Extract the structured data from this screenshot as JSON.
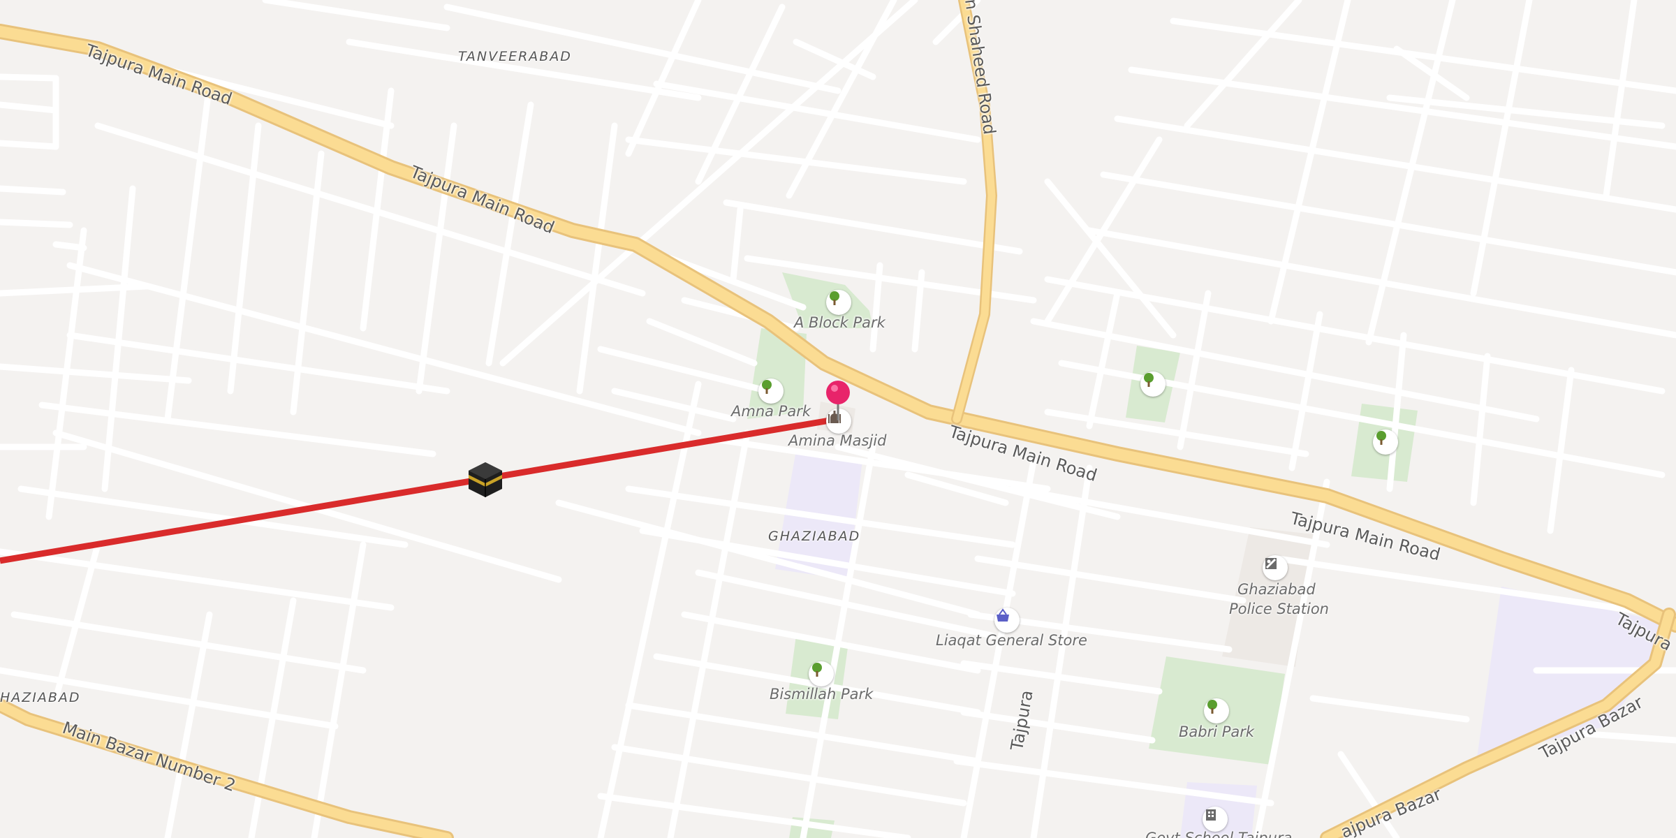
{
  "map": {
    "areas": {
      "tanveerabad": "TANVEERABAD",
      "ghaziabad": "GHAZIABAD",
      "ghaziabad_edge": "HAZIABAD"
    },
    "roads": {
      "tajpura_main_1": "Tajpura Main Road",
      "tajpura_main_2": "Tajpura Main Road",
      "tajpura_main_3": "Tajpura Main Road",
      "tajpura_main_4": "Tajpura Main Road",
      "tajpura_main_5": "Tajpura",
      "shaheed_road": "n Shaheed Road",
      "tajpura_street": "Tajpura",
      "main_bazar_2": "Main Bazar Number 2",
      "tajpura_bazar_1": "Tajpura Bazar",
      "tajpura_bazar_2": "ajpura Bazar"
    },
    "pois": {
      "a_block_park": "A Block Park",
      "amna_park": "Amna Park",
      "amina_masjid": "Amina Masjid",
      "liaqat_store": "Liaqat General Store",
      "bismillah_park": "Bismillah Park",
      "police_station_1": "Ghaziabad",
      "police_station_2": "Police Station",
      "babri_park": "Babri Park",
      "govt_school": "Govt School Tajpura"
    },
    "colors": {
      "background": "#f4f2f0",
      "minor_road": "#ffffff",
      "major_road": "#fbdc93",
      "major_road_casing": "#e8c27b",
      "park": "#d8ead0",
      "school": "#ece8f8",
      "route_line": "#d92b2b",
      "pin": "#e8246a",
      "tree_icon": "#5a9e2f"
    },
    "icons": {
      "pin": "location-pin-icon",
      "kaaba": "kaaba-icon",
      "tree": "tree-icon",
      "mosque": "mosque-icon",
      "shop": "shopping-basket-icon",
      "police": "police-icon",
      "school": "school-icon"
    }
  }
}
